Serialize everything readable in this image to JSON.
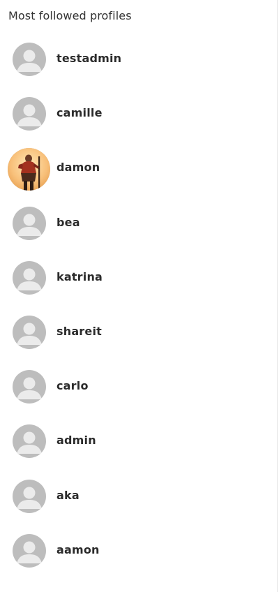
{
  "panel": {
    "title": "Most followed profiles"
  },
  "profiles": [
    {
      "name": "testadmin",
      "avatar": "default-avatar-icon"
    },
    {
      "name": "camille",
      "avatar": "default-avatar-icon"
    },
    {
      "name": "damon",
      "avatar": "profile-photo"
    },
    {
      "name": "bea",
      "avatar": "default-avatar-icon"
    },
    {
      "name": "katrina",
      "avatar": "default-avatar-icon"
    },
    {
      "name": "shareit",
      "avatar": "default-avatar-icon"
    },
    {
      "name": "carlo",
      "avatar": "default-avatar-icon"
    },
    {
      "name": "admin",
      "avatar": "default-avatar-icon"
    },
    {
      "name": "aka",
      "avatar": "default-avatar-icon"
    },
    {
      "name": "aamon",
      "avatar": "default-avatar-icon"
    }
  ],
  "colors": {
    "avatar_bg": "#bdbdbd",
    "avatar_figure": "#ebebeb",
    "text": "#2b2b2b",
    "border": "#e6e6e6"
  }
}
